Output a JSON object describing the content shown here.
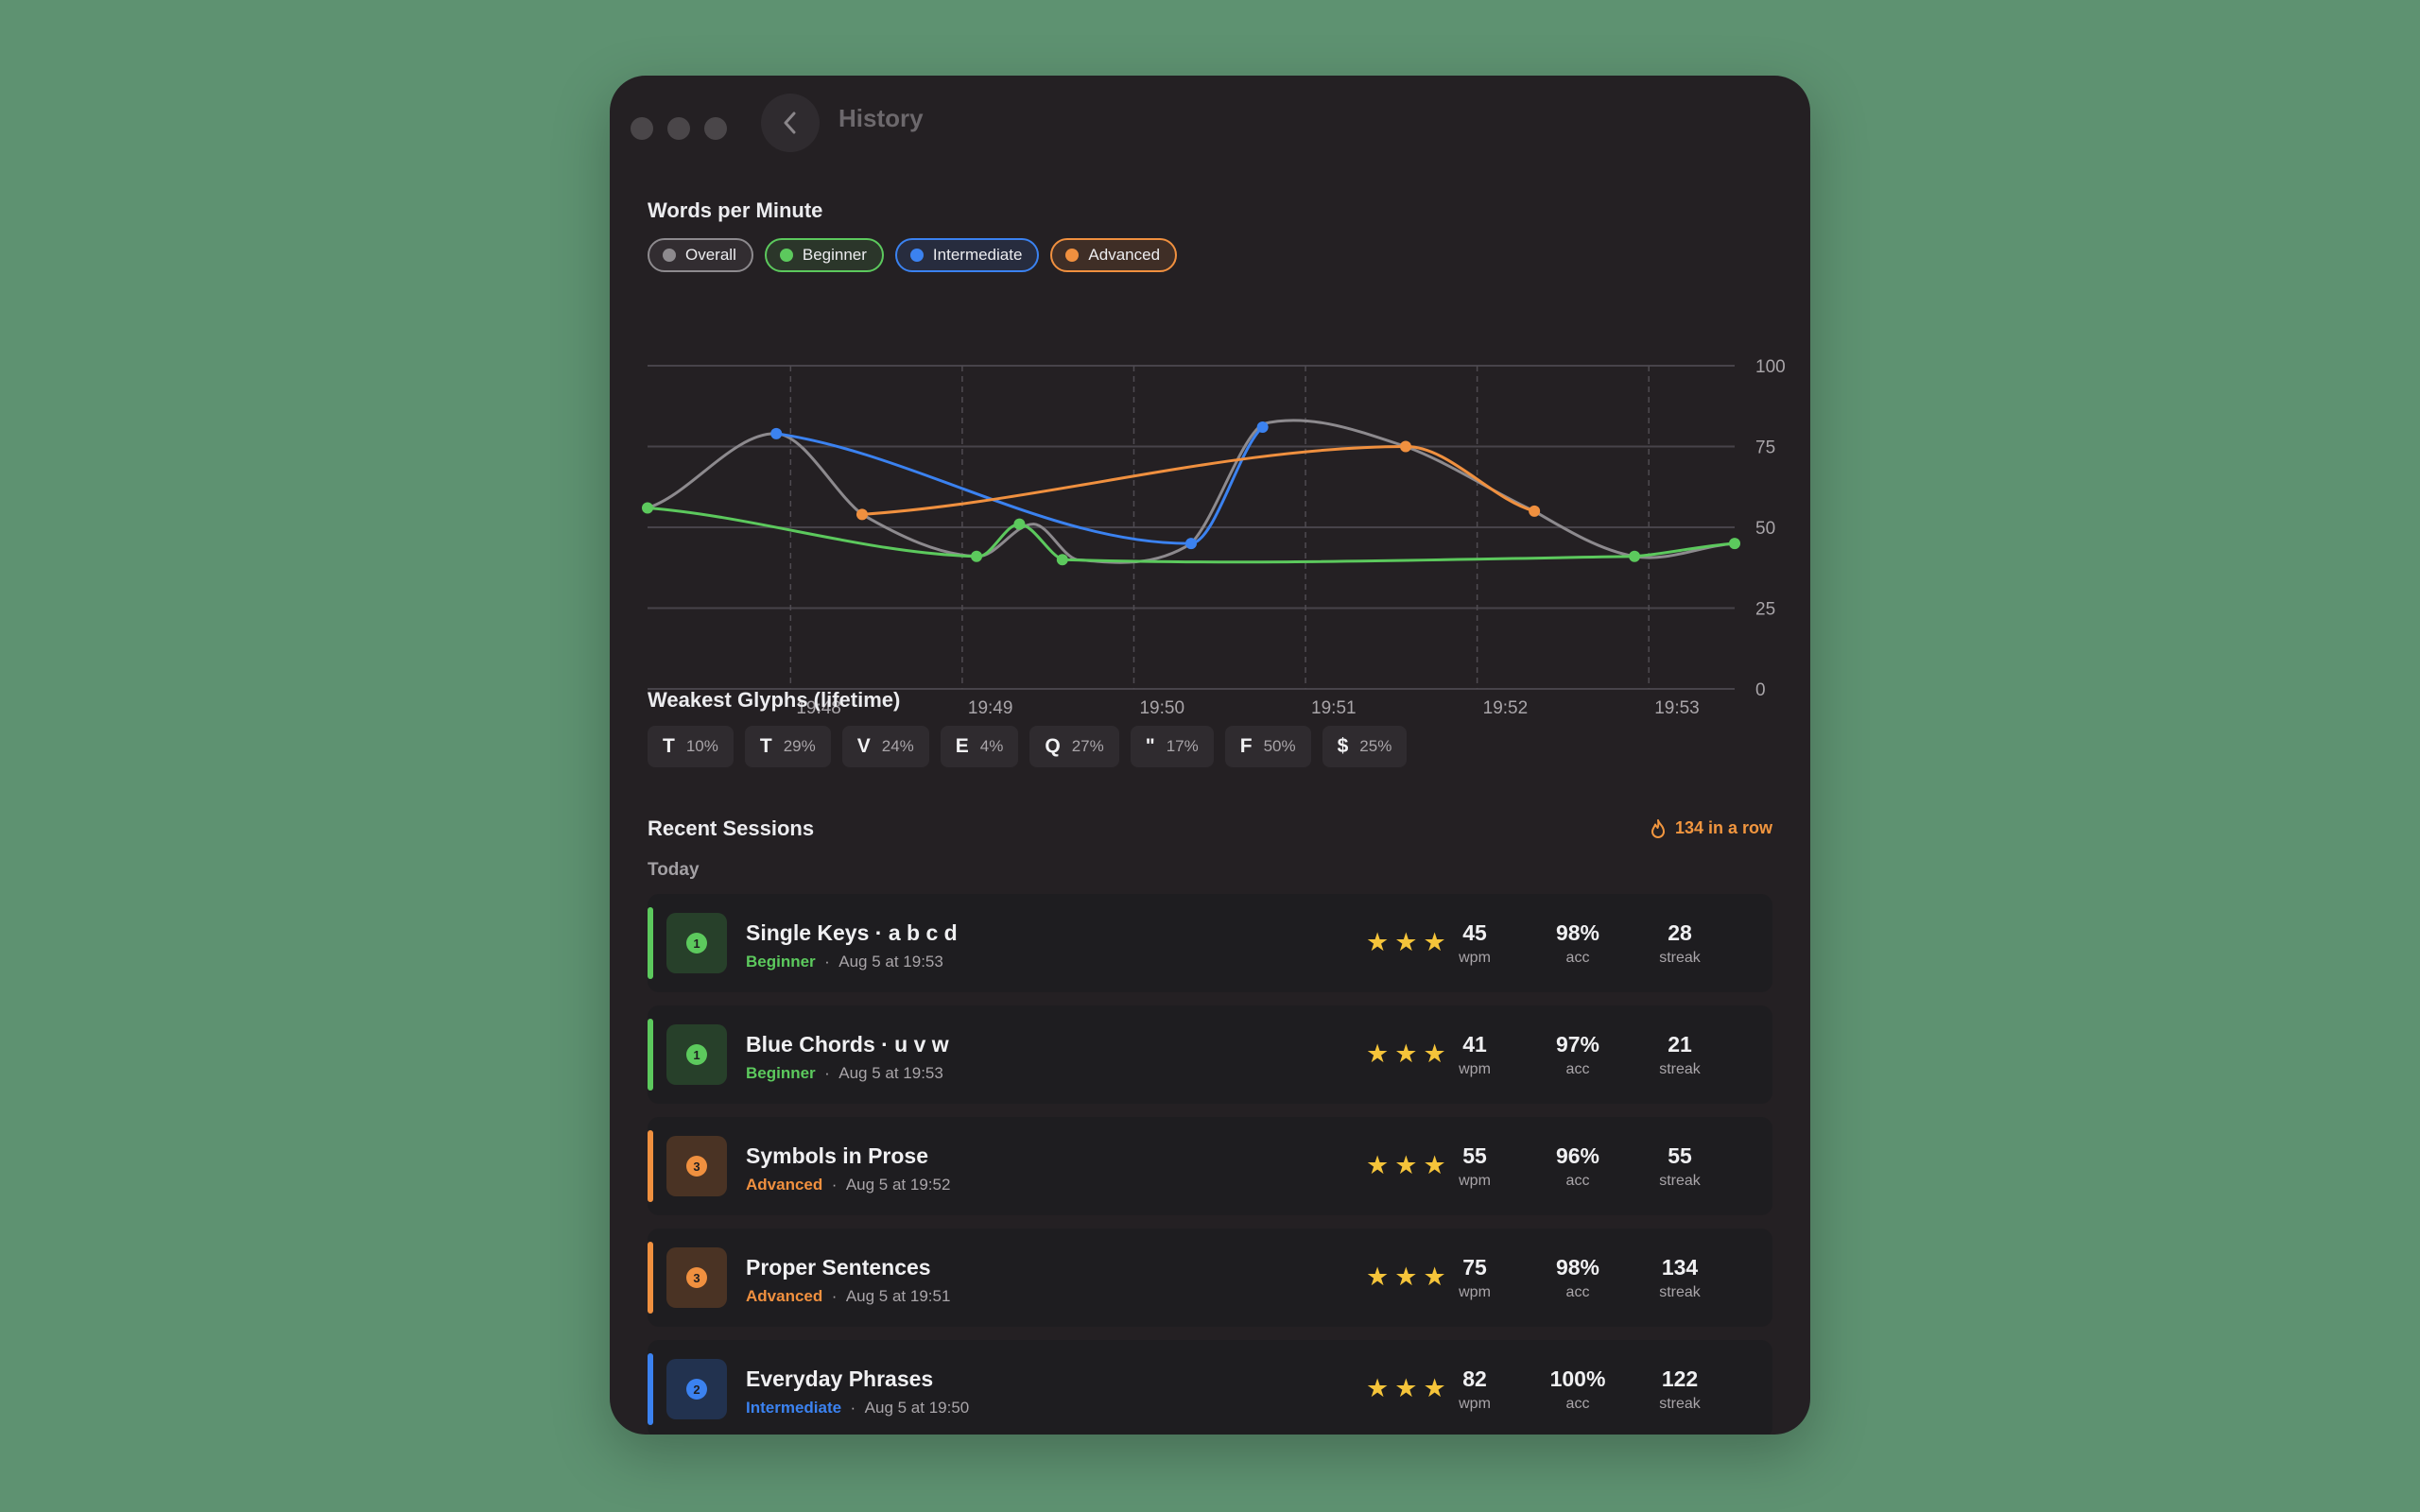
{
  "window": {
    "title": "History"
  },
  "chart_section": {
    "title": "Words per Minute"
  },
  "legend": [
    {
      "label": "Overall",
      "color": "#8d8a8e"
    },
    {
      "label": "Beginner",
      "color": "#5cc95d"
    },
    {
      "label": "Intermediate",
      "color": "#3b82f0"
    },
    {
      "label": "Advanced",
      "color": "#f0903f"
    }
  ],
  "chart_data": {
    "type": "line",
    "title": "Words per Minute",
    "xlabel": "",
    "ylabel": "",
    "x_ticks": [
      "19:48",
      "19:49",
      "19:50",
      "19:51",
      "19:52",
      "19:53"
    ],
    "y_ticks": [
      0,
      25,
      50,
      75,
      100
    ],
    "ylim": [
      0,
      100
    ],
    "xlim_minutes": [
      "19:47:10",
      "19:53:30"
    ],
    "grid": true,
    "series": [
      {
        "name": "Overall",
        "color": "#8d8a8e",
        "smooth": true,
        "markers": false,
        "points": [
          [
            "19:47:10",
            56
          ],
          [
            "19:47:55",
            79
          ],
          [
            "19:48:25",
            54
          ],
          [
            "19:49:05",
            41
          ],
          [
            "19:49:25",
            51
          ],
          [
            "19:49:40",
            40
          ],
          [
            "19:50:20",
            45
          ],
          [
            "19:50:45",
            82
          ],
          [
            "19:51:35",
            75
          ],
          [
            "19:52:20",
            55
          ],
          [
            "19:52:55",
            41
          ],
          [
            "19:53:30",
            45
          ]
        ]
      },
      {
        "name": "Beginner",
        "color": "#5cc95d",
        "smooth": true,
        "markers": true,
        "points": [
          [
            "19:47:10",
            56
          ],
          [
            "19:49:05",
            41
          ],
          [
            "19:49:20",
            51
          ],
          [
            "19:49:35",
            40
          ],
          [
            "19:52:55",
            41
          ],
          [
            "19:53:30",
            45
          ]
        ]
      },
      {
        "name": "Intermediate",
        "color": "#3b82f0",
        "smooth": true,
        "markers": true,
        "points": [
          [
            "19:47:55",
            79
          ],
          [
            "19:50:20",
            45
          ],
          [
            "19:50:45",
            81
          ]
        ]
      },
      {
        "name": "Advanced",
        "color": "#f0903f",
        "smooth": true,
        "markers": true,
        "points": [
          [
            "19:48:25",
            54
          ],
          [
            "19:51:35",
            75
          ],
          [
            "19:52:20",
            55
          ]
        ]
      }
    ]
  },
  "glyph_section": {
    "title": "Weakest Glyphs (lifetime)"
  },
  "glyphs": [
    {
      "glyph": "T",
      "pct": "10%"
    },
    {
      "glyph": "T",
      "pct": "29%"
    },
    {
      "glyph": "V",
      "pct": "24%"
    },
    {
      "glyph": "E",
      "pct": "4%"
    },
    {
      "glyph": "Q",
      "pct": "27%"
    },
    {
      "glyph": "\"",
      "pct": "17%"
    },
    {
      "glyph": "F",
      "pct": "50%"
    },
    {
      "glyph": "$",
      "pct": "25%"
    }
  ],
  "sessions_section": {
    "title": "Recent Sessions",
    "streak": "134 in a row",
    "group": "Today"
  },
  "sessions": [
    {
      "level_num": "1",
      "name": "Single Keys · a b c d",
      "level": "Beginner",
      "time": "Aug 5 at 19:53",
      "color": "#5cc95d",
      "badge_bg": "#27402a",
      "stars": 3,
      "wpm": "45",
      "acc": "98%",
      "streak": "28"
    },
    {
      "level_num": "1",
      "name": "Blue Chords · u v w",
      "level": "Beginner",
      "time": "Aug 5 at 19:53",
      "color": "#5cc95d",
      "badge_bg": "#27402a",
      "stars": 3,
      "wpm": "41",
      "acc": "97%",
      "streak": "21"
    },
    {
      "level_num": "3",
      "name": "Symbols in Prose",
      "level": "Advanced",
      "time": "Aug 5 at 19:52",
      "color": "#f0903f",
      "badge_bg": "#4a3324",
      "stars": 3,
      "wpm": "55",
      "acc": "96%",
      "streak": "55"
    },
    {
      "level_num": "3",
      "name": "Proper Sentences",
      "level": "Advanced",
      "time": "Aug 5 at 19:51",
      "color": "#f0903f",
      "badge_bg": "#4a3324",
      "stars": 3,
      "wpm": "75",
      "acc": "98%",
      "streak": "134"
    },
    {
      "level_num": "2",
      "name": "Everyday Phrases",
      "level": "Intermediate",
      "time": "Aug 5 at 19:50",
      "color": "#3b82f0",
      "badge_bg": "#22324f",
      "stars": 3,
      "wpm": "82",
      "acc": "100%",
      "streak": "122"
    }
  ],
  "labels": {
    "wpm": "wpm",
    "acc": "acc",
    "streak": "streak"
  }
}
